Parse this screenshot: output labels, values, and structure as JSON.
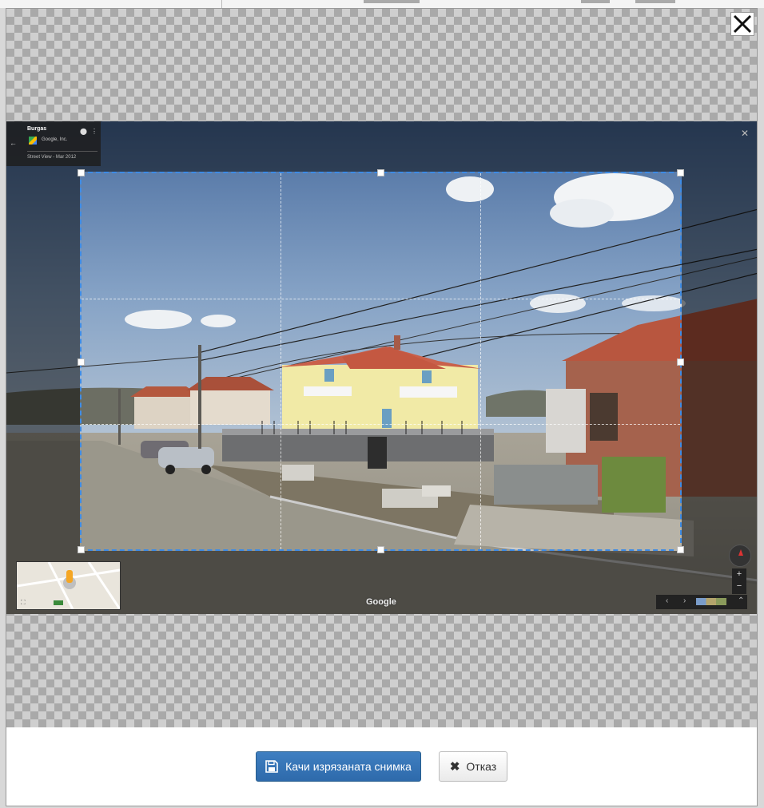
{
  "modal": {
    "close_label": "Close"
  },
  "streetview": {
    "location_title": "Burgas",
    "owner": "Google, Inc.",
    "capture_date": "Street View - Mar 2012",
    "watermark": "Google"
  },
  "crop": {
    "grid_lines": "rule-of-thirds"
  },
  "footer": {
    "upload_label": "Качи изрязаната снимка",
    "upload_icon": "floppy-disk-icon",
    "cancel_label": "Отказ",
    "cancel_icon": "close-icon"
  },
  "colors": {
    "primary_button": "#337ab7",
    "crop_border": "#3d8be5",
    "checker_light": "#cfcfcf",
    "checker_dark": "#a9a9a9"
  }
}
